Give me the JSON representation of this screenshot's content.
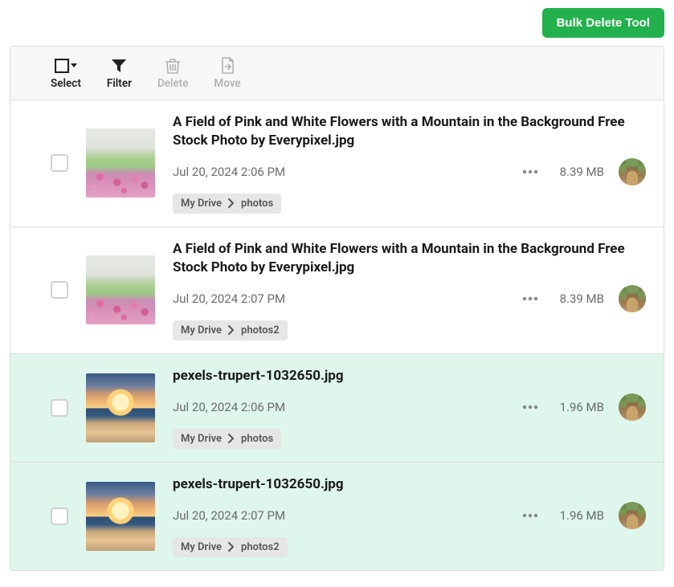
{
  "header": {
    "bulk_delete_label": "Bulk Delete Tool"
  },
  "toolbar": {
    "select_label": "Select",
    "filter_label": "Filter",
    "delete_label": "Delete",
    "move_label": "Move"
  },
  "files": [
    {
      "title": "A Field of Pink and White Flowers with a Mountain in the Background Free Stock Photo by Everypixel.jpg",
      "date": "Jul 20, 2024 2:06 PM",
      "size": "8.39 MB",
      "path_root": "My Drive",
      "path_folder": "photos",
      "thumb": "flowers",
      "highlighted": false
    },
    {
      "title": "A Field of Pink and White Flowers with a Mountain in the Background Free Stock Photo by Everypixel.jpg",
      "date": "Jul 20, 2024 2:07 PM",
      "size": "8.39 MB",
      "path_root": "My Drive",
      "path_folder": "photos2",
      "thumb": "flowers",
      "highlighted": false
    },
    {
      "title": "pexels-trupert-1032650.jpg",
      "date": "Jul 20, 2024 2:06 PM",
      "size": "1.96 MB",
      "path_root": "My Drive",
      "path_folder": "photos",
      "thumb": "sunset",
      "highlighted": true
    },
    {
      "title": "pexels-trupert-1032650.jpg",
      "date": "Jul 20, 2024 2:07 PM",
      "size": "1.96 MB",
      "path_root": "My Drive",
      "path_folder": "photos2",
      "thumb": "sunset",
      "highlighted": true
    }
  ]
}
